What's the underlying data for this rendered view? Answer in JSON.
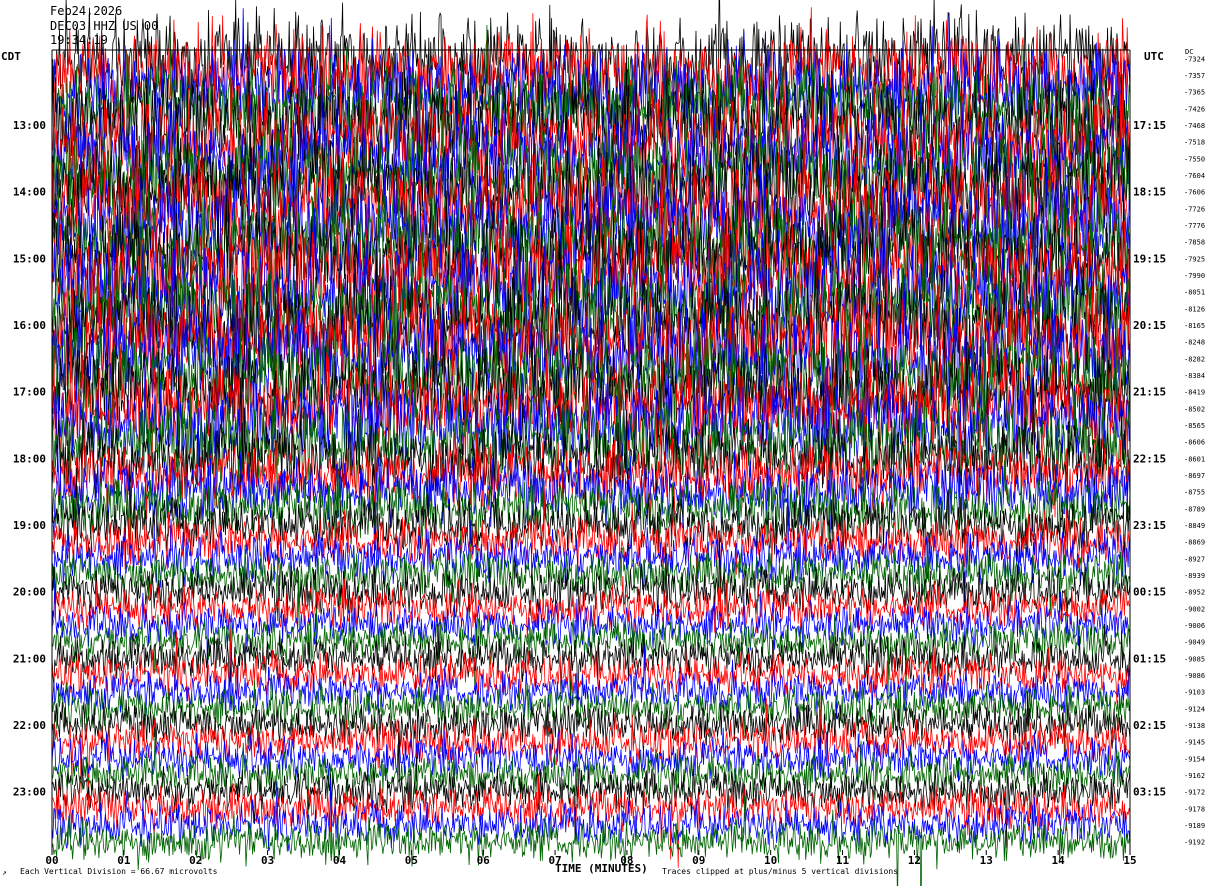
{
  "header": {
    "date": "Feb24,2026",
    "station": "DEC03 HHZ US 00",
    "run": "19:34:19"
  },
  "timezones": {
    "local": "CDT",
    "utc": "UTC"
  },
  "offset_label": "DC",
  "footer": {
    "xlabel": "TIME (MINUTES)",
    "scale_note": "Each Vertical Division =   66.67 microvolts",
    "clip_note": "Traces clipped at plus/minus 5 vertical divisions",
    "corner_mark": "↗"
  },
  "trace_colors": [
    "#000000",
    "#ff0000",
    "#0000ff",
    "#006400"
  ],
  "chart_data": {
    "type": "line",
    "title": "Feb24,2026",
    "xlabel": "TIME (MINUTES)",
    "xlim": [
      0,
      15
    ],
    "x_ticks": [
      "00",
      "01",
      "02",
      "03",
      "04",
      "05",
      "06",
      "07",
      "08",
      "09",
      "10",
      "11",
      "12",
      "13",
      "14",
      "15"
    ],
    "trace_count": 48,
    "traces_per_hour": 4,
    "left_hour_labels": [
      "13:00",
      "14:00",
      "15:00",
      "16:00",
      "17:00",
      "18:00",
      "19:00",
      "20:00",
      "21:00",
      "22:00",
      "23:00"
    ],
    "right_hour_labels": [
      "17:15",
      "18:15",
      "19:15",
      "20:15",
      "21:15",
      "22:15",
      "23:15",
      "00:15",
      "01:15",
      "02:15",
      "03:15"
    ],
    "dc_offsets": [
      "-7324",
      "-7357",
      "-7365",
      "-7426",
      "-7468",
      "-7518",
      "-7550",
      "-7604",
      "-7606",
      "-7726",
      "-7776",
      "-7858",
      "-7925",
      "-7990",
      "-8051",
      "-8126",
      "-8165",
      "-8248",
      "-8282",
      "-8384",
      "-8419",
      "-8502",
      "-8565",
      "-8606",
      "-8601",
      "-8697",
      "-8755",
      "-8789",
      "-8849",
      "-8869",
      "-8927",
      "-8939",
      "-8952",
      "-9002",
      "-9006",
      "-9049",
      "-9085",
      "-9086",
      "-9103",
      "-9124",
      "-9138",
      "-9145",
      "-9154",
      "-9162",
      "-9172",
      "-9178",
      "-9189",
      "-9192"
    ],
    "amplitude_by_trace": [
      2.2,
      2.2,
      2.3,
      2.3,
      2.4,
      2.4,
      2.4,
      2.4,
      2.5,
      2.5,
      2.5,
      2.5,
      2.5,
      2.5,
      2.5,
      2.5,
      2.5,
      2.5,
      2.4,
      2.4,
      2.3,
      2.2,
      2.1,
      2.0,
      1.8,
      1.6,
      1.5,
      1.4,
      1.3,
      1.2,
      1.15,
      1.1,
      1.1,
      1.05,
      1.0,
      1.0,
      1.0,
      1.0,
      1.0,
      1.0,
      1.0,
      1.0,
      1.0,
      1.0,
      1.0,
      1.0,
      1.0,
      1.0
    ],
    "grid": "none",
    "scale_microvolts_per_division": 66.67,
    "clip_divisions": 5
  }
}
